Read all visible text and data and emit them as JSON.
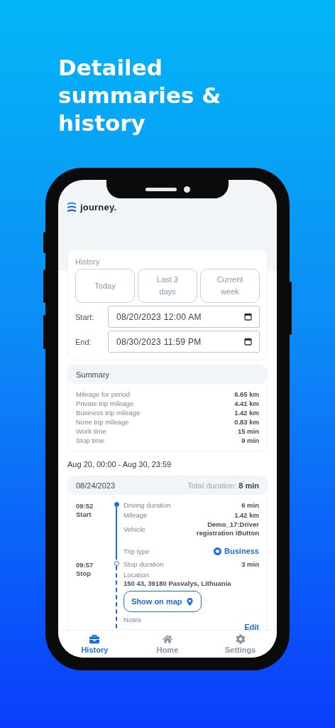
{
  "headline": [
    "Detailed",
    "summaries &",
    "history"
  ],
  "app": {
    "logo": "journey."
  },
  "history": {
    "title": "History",
    "presets": [
      {
        "label": "Today",
        "selected": false
      },
      {
        "label": "Last 3 days",
        "selected": false
      },
      {
        "label": "Current week",
        "selected": false
      }
    ],
    "start": {
      "label": "Start:",
      "value": "08/20/2023 12:00 AM"
    },
    "end": {
      "label": "End:",
      "value": "08/30/2023 11:59 PM"
    }
  },
  "summary": {
    "title": "Summary",
    "rows": [
      {
        "label": "Mileage for period",
        "value": "6.65 km"
      },
      {
        "label": "Private trip mileage",
        "value": "4.41 km"
      },
      {
        "label": "Business trip mileage",
        "value": "1.42 km"
      },
      {
        "label": "None trip mileage",
        "value": "0.83 km"
      },
      {
        "label": "Work time",
        "value": "15 min"
      },
      {
        "label": "Stop time",
        "value": "9 min"
      }
    ]
  },
  "period": "Aug 20, 00:00 - Aug 30, 23:59",
  "day": {
    "date": "08/24/2023",
    "total": "Total duration: **8 min**",
    "events": [
      {
        "kind": "drive",
        "time": "09:52",
        "label": "Start",
        "rows": [
          {
            "kind": "pair",
            "label": "Driving duration",
            "value": "6 min"
          },
          {
            "kind": "pair",
            "label": "Mileage",
            "value": "1.42 km"
          },
          {
            "kind": "pair",
            "label": "Vehicle",
            "value": "Demo_17:Driver registration iButton"
          },
          {
            "kind": "trip_type",
            "label": "Trip type",
            "value": "Business"
          }
        ]
      },
      {
        "kind": "stop",
        "time": "09:57",
        "label": "Stop",
        "rows": [
          {
            "kind": "pair",
            "label": "Stop duration",
            "value": "3 min"
          },
          {
            "kind": "stacked",
            "label": "Location",
            "value": "150 43, 39180 Pasvalys, Lithuania"
          },
          {
            "kind": "map_button",
            "value": "Show on map"
          },
          {
            "kind": "note",
            "label": "Notes",
            "value": "Edit"
          }
        ]
      }
    ]
  },
  "nav": [
    {
      "label": "History",
      "kind": "briefcase",
      "selected": true
    },
    {
      "label": "Home",
      "kind": "home",
      "selected": false
    },
    {
      "label": "Settings",
      "kind": "gear",
      "selected": false
    }
  ]
}
